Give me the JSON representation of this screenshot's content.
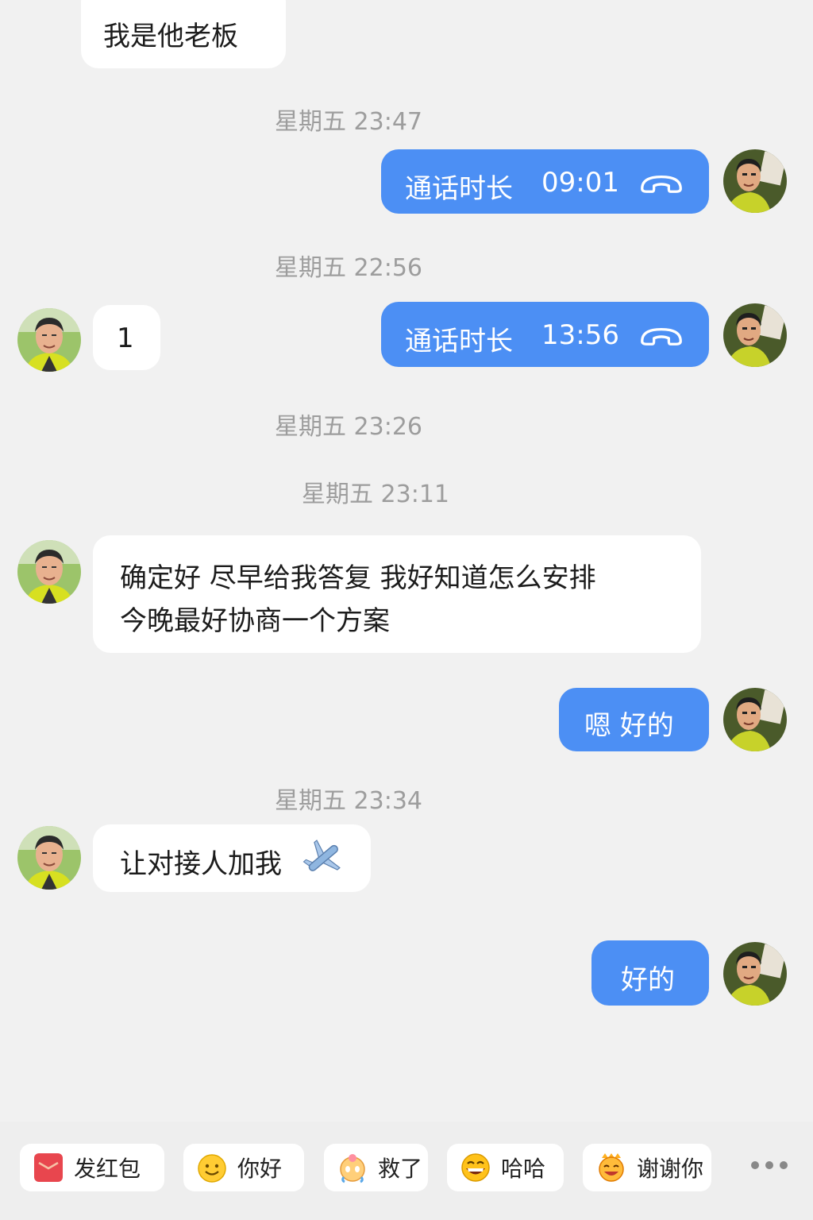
{
  "messages": {
    "m1": {
      "text": "我是他老板"
    },
    "ts1": "星期五 23:47",
    "call1": {
      "label": "通话时长",
      "duration": "09:01"
    },
    "ts2": "星期五 22:56",
    "m2": {
      "text": "1"
    },
    "call2": {
      "label": "通话时长",
      "duration": "13:56"
    },
    "ts3": "星期五 23:26",
    "ts4": "星期五 23:11",
    "m3": {
      "line1": "确定好 尽早给我答复 我好知道怎么安排",
      "line2": "今晚最好协商一个方案"
    },
    "m4": {
      "text": "嗯 好的"
    },
    "ts5": "星期五 23:34",
    "m5": {
      "text": "让对接人加我"
    },
    "m6": {
      "text": "好的"
    }
  },
  "quick_replies": [
    {
      "label": "发红包",
      "icon": "red-packet-icon",
      "color": "#e8464e"
    },
    {
      "label": "你好",
      "icon": "smile-emoji-icon"
    },
    {
      "label": "救了",
      "icon": "crying-emoji-icon"
    },
    {
      "label": "哈哈",
      "icon": "laugh-emoji-icon"
    },
    {
      "label": "谢谢你",
      "icon": "thanks-emoji-icon"
    }
  ],
  "colors": {
    "outgoing_bubble": "#4c8ff4",
    "incoming_bubble": "#ffffff",
    "background": "#f1f1f1",
    "timestamp": "#9d9d9d"
  },
  "icons": {
    "call": "phone-hangup-icon",
    "plane": "airplane-emoji-icon",
    "more": "more-dots-icon"
  }
}
